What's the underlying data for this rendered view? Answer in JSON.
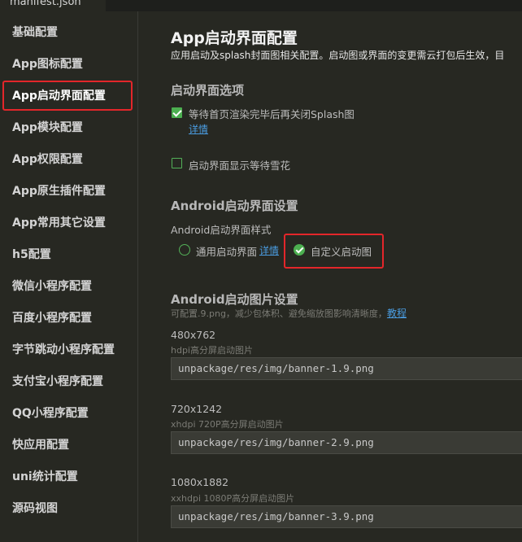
{
  "tab": {
    "label": "manifest.json"
  },
  "sidebar": {
    "items": [
      {
        "label": "基础配置"
      },
      {
        "label": "App图标配置"
      },
      {
        "label": "App启动界面配置",
        "active": true
      },
      {
        "label": "App模块配置"
      },
      {
        "label": "App权限配置"
      },
      {
        "label": "App原生插件配置"
      },
      {
        "label": "App常用其它设置"
      },
      {
        "label": "h5配置"
      },
      {
        "label": "微信小程序配置"
      },
      {
        "label": "百度小程序配置"
      },
      {
        "label": "字节跳动小程序配置"
      },
      {
        "label": "支付宝小程序配置"
      },
      {
        "label": "QQ小程序配置"
      },
      {
        "label": "快应用配置"
      },
      {
        "label": "uni统计配置"
      },
      {
        "label": "源码视图"
      }
    ]
  },
  "main": {
    "title": "App启动界面配置",
    "description": "应用启动及splash封面图相关配置。启动图或界面的变更需云打包后生效，目",
    "splash_options": {
      "title": "启动界面选项",
      "wait_render": {
        "label": "等待首页渲染完毕后再关闭Splash图",
        "checked": true,
        "link": "详情"
      },
      "show_snowflake": {
        "label": "启动界面显示等待雪花",
        "checked": false
      }
    },
    "android_splash": {
      "title": "Android启动界面设置",
      "style_label": "Android启动界面样式",
      "option_default": {
        "label": "通用启动界面",
        "link": "详情",
        "selected": false
      },
      "option_custom": {
        "label": "自定义启动图",
        "selected": true
      }
    },
    "android_images": {
      "title": "Android启动图片设置",
      "hint": "可配置.9.png，减少包体积、避免缩放图影响清晰度，",
      "hint_link": "教程",
      "images": [
        {
          "size": "480x762",
          "desc": "hdpi高分屏启动图片",
          "value": "unpackage/res/img/banner-1.9.png"
        },
        {
          "size": "720x1242",
          "desc": "xhdpi 720P高分屏启动图片",
          "value": "unpackage/res/img/banner-2.9.png"
        },
        {
          "size": "1080x1882",
          "desc": "xxhdpi 1080P高分屏启动图片",
          "value": "unpackage/res/img/banner-3.9.png"
        }
      ]
    }
  },
  "colors": {
    "accent_green": "#4caf50",
    "highlight_red": "#e3262a",
    "link_blue": "#4a9ce0",
    "background": "#272822"
  }
}
